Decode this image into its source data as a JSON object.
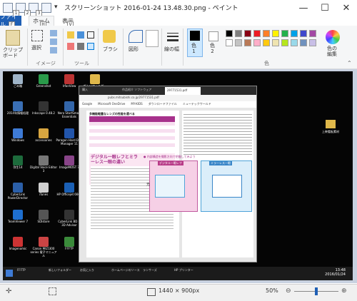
{
  "window": {
    "title": "スクリーンショット 2016-01-24 13.48.30.png - ペイント",
    "minimize": "—",
    "maximize": "☐",
    "close": "✕"
  },
  "ribbon_tabs": {
    "file": "ファイル",
    "home": "ホーム",
    "view": "表示"
  },
  "keytips": {
    "qat1": "1",
    "qat2": "2",
    "qat3": "3",
    "file": "F",
    "home": "H",
    "view": "V"
  },
  "ribbon": {
    "clipboard_label": "クリップボード",
    "select_label": "選択",
    "image_group": "イメージ",
    "tools_group": "ツール",
    "brush_label": "ブラシ",
    "shapes_label": "図形",
    "line_width_label": "線の幅",
    "color1_label": "色\n1",
    "color2_label": "色\n2",
    "edit_colors_label": "色の\n編集",
    "colors_group": "色",
    "palette_row1": [
      "#000000",
      "#7f7f7f",
      "#880015",
      "#ed1c24",
      "#ff7f27",
      "#fff200",
      "#22b14c",
      "#00a2e8",
      "#3f48cc",
      "#a349a4"
    ],
    "palette_row2": [
      "#ffffff",
      "#c3c3c3",
      "#b97a57",
      "#ffaec9",
      "#ffc90e",
      "#efe4b0",
      "#b5e61d",
      "#99d9ea",
      "#7092be",
      "#c8bfe7"
    ]
  },
  "desktop": {
    "icons": [
      {
        "label": "ごみ箱",
        "color": "#9fb4c8"
      },
      {
        "label": "2014年情報処理",
        "color": "#3a6fb5"
      },
      {
        "label": "Windows",
        "color": "#3e7bd6"
      },
      {
        "label": "弥生14",
        "color": "#1d6b3c"
      },
      {
        "label": "CyberLink PowerDirector",
        "color": "#2b5fa8"
      },
      {
        "label": "TeamViewer 7",
        "color": "#1e6fd0"
      },
      {
        "label": "Imagenomic",
        "color": "#c33"
      },
      {
        "label": "Greenshot",
        "color": "#2a9a4a"
      },
      {
        "label": "Inkscape 0.48.2",
        "color": "#333"
      },
      {
        "label": "accessories",
        "color": "#d8a640"
      },
      {
        "label": "Digital Voice Editor 3",
        "color": "#777"
      },
      {
        "label": "iTunes",
        "color": "#d0d0d0"
      },
      {
        "label": "SDIstore",
        "color": "#555"
      },
      {
        "label": "Canon MG5300 series 電子マニュアル",
        "color": "#c44"
      },
      {
        "label": "IrfanView",
        "color": "#b33"
      },
      {
        "label": "Nero StartSmart Essentials",
        "color": "#3366aa"
      },
      {
        "label": "Paragon Hard Disk Manager 11",
        "color": "#2255aa"
      },
      {
        "label": "ImageMOST 7",
        "color": "#884488"
      },
      {
        "label": "HP Officejet 6600",
        "color": "#1a5fb4"
      },
      {
        "label": "CyberLink BD & 3D Advisor",
        "color": "#333"
      },
      {
        "label": "FFFTP",
        "color": "#3a8a3a"
      },
      {
        "label": "新しいフォルダー",
        "color": "#e0b84a"
      }
    ],
    "right_folder": "上映看板素材"
  },
  "browser": {
    "tab1": "購入",
    "tab2": "作品紹介 ソフトウェア",
    "tab3": "29771531.pdf",
    "bookmarks": [
      "Google",
      "Microsoft OneDrive",
      "MY-KIDS",
      "ダウンロードファイル",
      "ミューテックワールド"
    ],
    "url": "pubs.mitsubishi.co.jp/29771531.pdf",
    "doc_heading1": "多機能軽量なレンズの性能を選べる",
    "doc_heading2": "デジタル一眼レフとミラーレス一眼の違い",
    "doc_section2": "● 内部構造を撮影方向で把握してみよう",
    "slr_label": "デジタル一眼レフ",
    "mirrorless_label": "ミラーレス一眼",
    "light_label": "光"
  },
  "taskbar": {
    "time": "13:48",
    "date": "2016/01/24",
    "items": [
      "FFFTP",
      "新しいフォルダー",
      "お気に入り",
      "ホームページのソース",
      "ランサーズ",
      "HP プリンター"
    ]
  },
  "statusbar": {
    "dimensions": "1440 × 900px",
    "zoom": "50%",
    "zoom_fraction": 0.5
  }
}
